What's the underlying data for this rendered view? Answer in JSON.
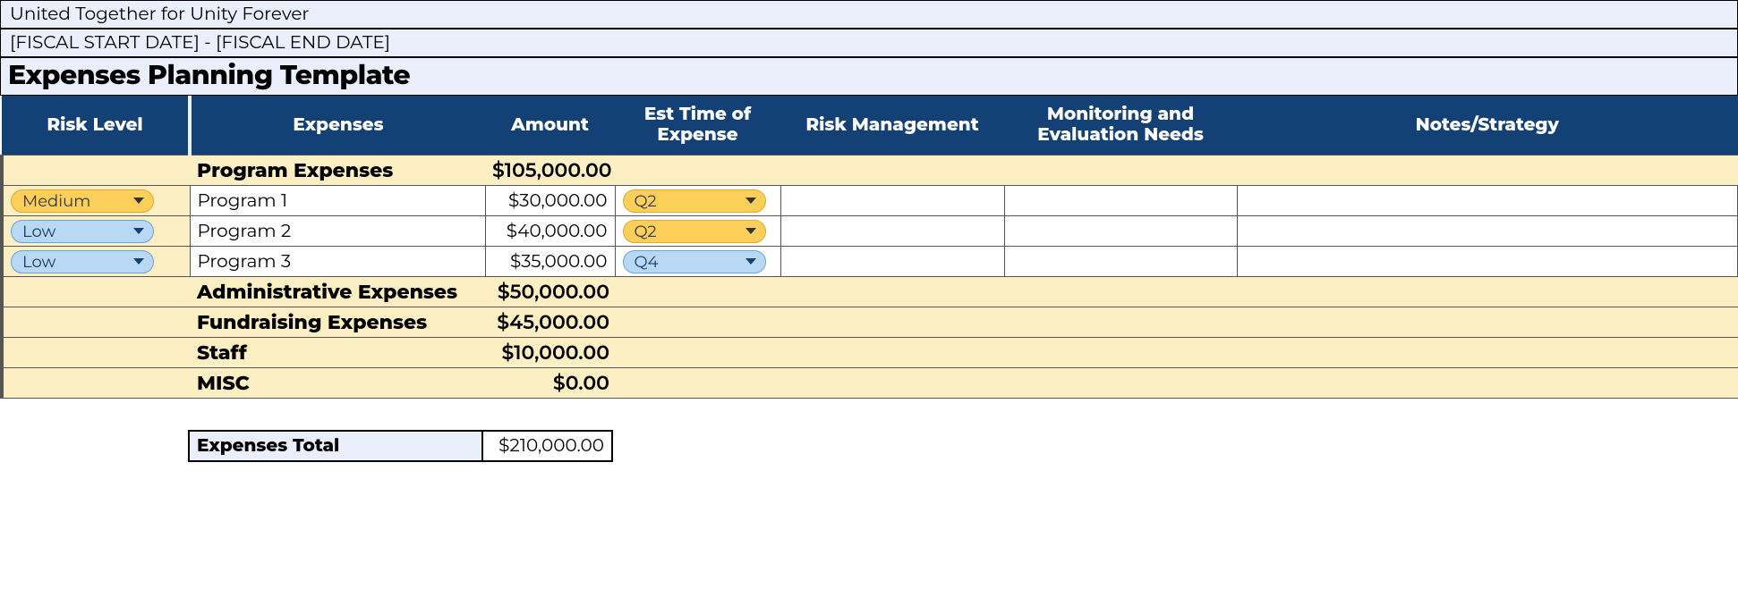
{
  "header": {
    "org": "United Together for Unity Forever",
    "fiscal": "[FISCAL START DATE] - [FISCAL END DATE]",
    "title": "Expenses Planning Template"
  },
  "columns": {
    "risk": "Risk Level",
    "expenses": "Expenses",
    "amount": "Amount",
    "time": "Est Time of Expense",
    "risk_mgmt": "Risk Management",
    "monitoring": "Monitoring and Evaluation Needs",
    "notes": "Notes/Strategy"
  },
  "categories": [
    {
      "label": "Program Expenses",
      "amount": "$105,000.00"
    },
    {
      "label": "Administrative Expenses",
      "amount": "$50,000.00"
    },
    {
      "label": "Fundraising Expenses",
      "amount": "$45,000.00"
    },
    {
      "label": "Staff",
      "amount": "$10,000.00"
    },
    {
      "label": "MISC",
      "amount": "$0.00"
    }
  ],
  "programs": [
    {
      "risk": "Medium",
      "risk_class": "medium",
      "name": "Program 1",
      "amount": "$30,000.00",
      "time": "Q2",
      "time_class": "q-orange",
      "risk_mgmt": "",
      "monitoring": "",
      "notes": ""
    },
    {
      "risk": "Low",
      "risk_class": "low",
      "name": "Program 2",
      "amount": "$40,000.00",
      "time": "Q2",
      "time_class": "q-orange",
      "risk_mgmt": "",
      "monitoring": "",
      "notes": ""
    },
    {
      "risk": "Low",
      "risk_class": "low",
      "name": "Program 3",
      "amount": "$35,000.00",
      "time": "Q4",
      "time_class": "q-blue",
      "risk_mgmt": "",
      "monitoring": "",
      "notes": ""
    }
  ],
  "total": {
    "label": "Expenses Total",
    "amount": "$210,000.00"
  }
}
